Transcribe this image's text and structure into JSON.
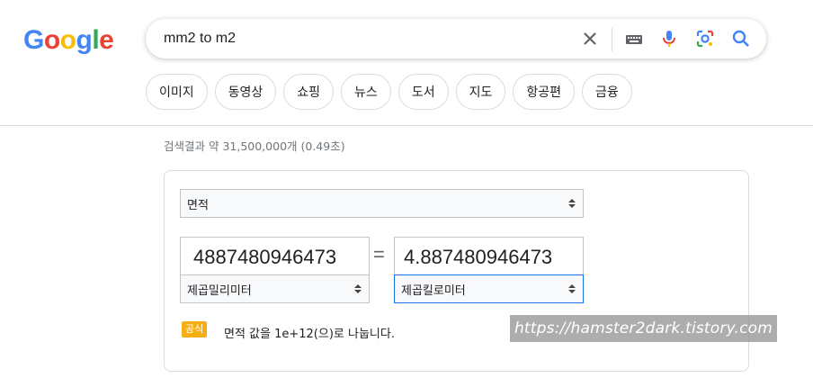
{
  "logo": {
    "letters": [
      "G",
      "o",
      "o",
      "g",
      "l",
      "e"
    ],
    "colors": [
      "#4285F4",
      "#EA4335",
      "#FBBC05",
      "#4285F4",
      "#34A853",
      "#EA4335"
    ]
  },
  "search": {
    "query": "mm2 to m2"
  },
  "tabs": [
    "이미지",
    "동영상",
    "쇼핑",
    "뉴스",
    "도서",
    "지도",
    "항공편",
    "금융"
  ],
  "result_stats": "검색결과 약 31,500,000개 (0.49초)",
  "converter": {
    "unit_type": "면적",
    "from_value": "4887480946473",
    "to_value": "4.887480946473",
    "equals": "=",
    "from_unit": "제곱밀리미터",
    "to_unit": "제곱킬로미터",
    "formula_badge": "공식",
    "formula_text": "면적 값을 1e+12(으)로 나눕니다."
  },
  "watermark": "https://hamster2dark.tistory.com",
  "colors": {
    "accent": "#1a73e8",
    "badge": "#f6ae13"
  }
}
